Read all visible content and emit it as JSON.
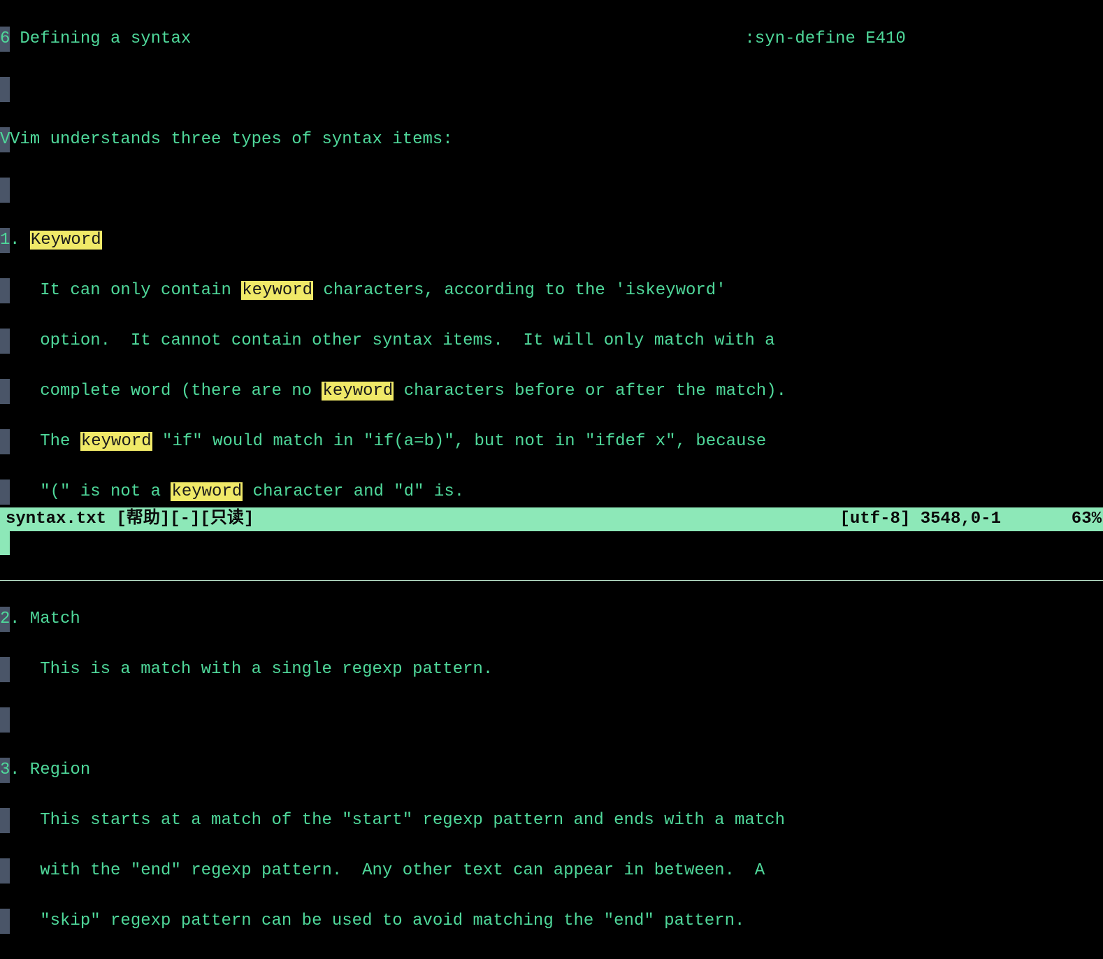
{
  "heading": {
    "number": "6.",
    "title": " Defining a syntax",
    "tag": ":syn-define E410"
  },
  "intro": "Vim understands three types of syntax items:",
  "highlight_word": "keyword",
  "item1": {
    "num": "1.",
    "title": "Keyword",
    "l1a": "   It can only contain ",
    "l1b": " characters, according to the 'iskeyword'",
    "l2": "   option.  It cannot contain other syntax items.  It will only match with a",
    "l3a": "   complete word (there are no ",
    "l3b": " characters before or after the match).",
    "l4a": "   The ",
    "l4b": " \"if\" would match in \"if(a=b)\", but not in \"ifdef x\", because",
    "l5a": "   \"(\" is not a ",
    "l5b": " character and \"d\" is."
  },
  "item2": {
    "num": "2.",
    "title": " Match",
    "l1": "   This is a match with a single regexp pattern."
  },
  "item3": {
    "num": "3.",
    "title": " Region",
    "l1": "   This starts at a match of the \"start\" regexp pattern and ends with a match",
    "l2": "   with the \"end\" regexp pattern.  Any other text can appear in between.  A",
    "l3": "   \"skip\" regexp pattern can be used to avoid matching the \"end\" pattern."
  },
  "status": {
    "left": "syntax.txt [帮助][-][只读]",
    "right": "[utf-8] 3548,0-1       63%"
  }
}
